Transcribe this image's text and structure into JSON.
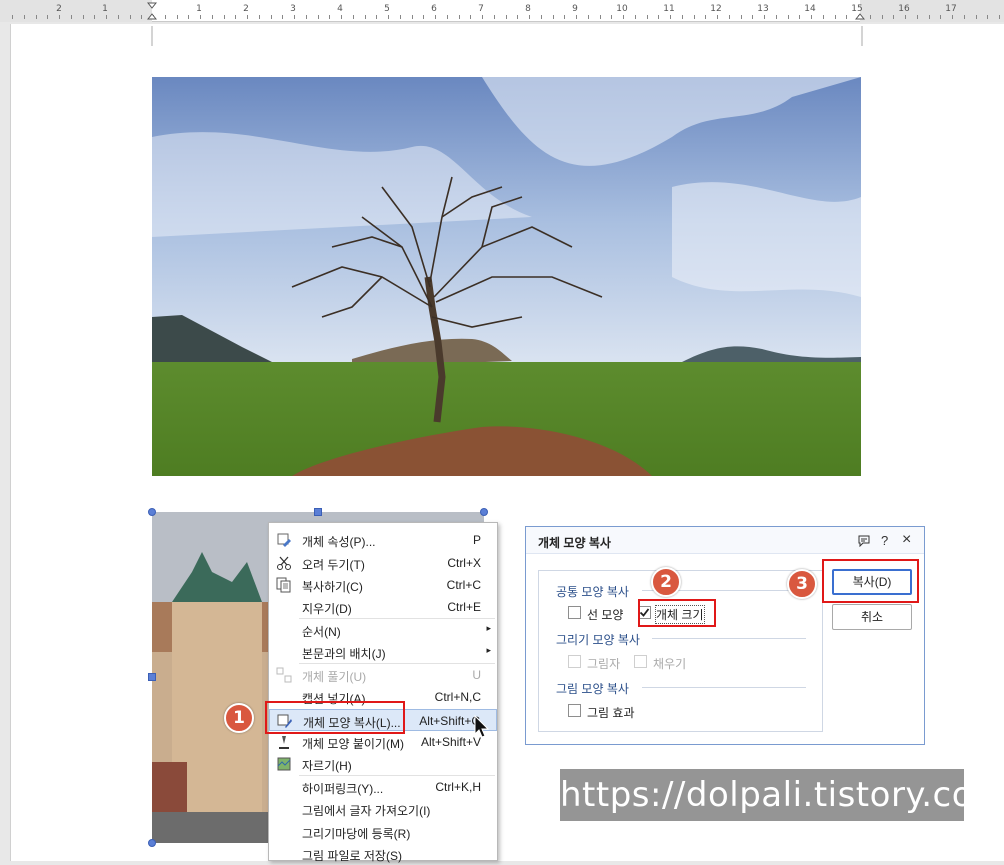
{
  "ruler": {
    "numbers": [
      "2",
      "1",
      "1",
      "2",
      "3",
      "4",
      "5",
      "6",
      "7",
      "8",
      "9",
      "10",
      "11",
      "12",
      "13",
      "14",
      "15",
      "16",
      "17"
    ]
  },
  "menu": {
    "items": [
      {
        "label": "개체 속성(P)...",
        "shortcut": "P",
        "icon": "properties-icon"
      },
      {
        "label": "오려 두기(T)",
        "shortcut": "Ctrl+X",
        "icon": "scissors-icon"
      },
      {
        "label": "복사하기(C)",
        "shortcut": "Ctrl+C",
        "icon": "copy-icon"
      },
      {
        "label": "지우기(D)",
        "shortcut": "Ctrl+E"
      },
      {
        "label": "순서(N)",
        "submenu": true
      },
      {
        "label": "본문과의 배치(J)",
        "submenu": true
      },
      {
        "label": "개체 풀기(U)",
        "shortcut": "U",
        "disabled": true,
        "icon": "ungroup-icon"
      },
      {
        "label": "캡션 넣기(A)",
        "shortcut": "Ctrl+N,C"
      },
      {
        "label": "개체 모양 복사(L)...",
        "shortcut": "Alt+Shift+C",
        "icon": "format-copy-icon",
        "highlighted": true
      },
      {
        "label": "개체 모양 붙이기(M)",
        "shortcut": "Alt+Shift+V",
        "icon": "format-paste-icon"
      },
      {
        "label": "자르기(H)",
        "icon": "crop-icon"
      },
      {
        "label": "하이퍼링크(Y)...",
        "shortcut": "Ctrl+K,H"
      },
      {
        "label": "그림에서 글자 가져오기(I)"
      },
      {
        "label": "그리기마당에 등록(R)"
      },
      {
        "label": "그림 파일로 저장(S)"
      }
    ]
  },
  "dialog": {
    "title": "개체 모양 복사",
    "group_common": "공통 모양 복사",
    "line_shape": "선 모양",
    "object_size": "개체 크기",
    "group_drawing": "그리기 모양 복사",
    "shadow": "그림자",
    "fill": "채우기",
    "group_picture": "그림 모양 복사",
    "picture_effect": "그림 효과",
    "copy_button": "복사(D)",
    "cancel_button": "취소",
    "help": "?",
    "close": "×"
  },
  "badges": {
    "one": "1",
    "two": "2",
    "three": "3"
  },
  "watermark": "https://dolpali.tistory.com",
  "colors": {
    "accent": "#3a6fd0",
    "annotation": "#e01818",
    "badge": "#d9583f"
  }
}
